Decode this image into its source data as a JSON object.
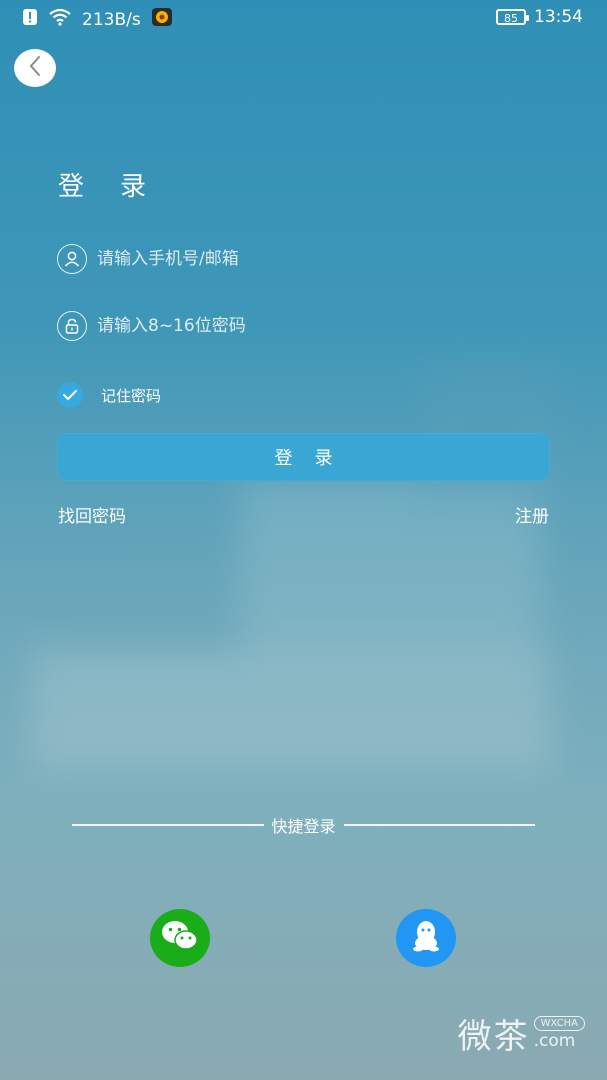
{
  "status_bar": {
    "speed": "213B/s",
    "battery": "85",
    "time": "13:54"
  },
  "login": {
    "title": "登录",
    "phone_placeholder": "请输入手机号/邮箱",
    "password_placeholder": "请输入8~16位密码",
    "remember_label": "记住密码",
    "remember_checked": true,
    "submit_label": "登录",
    "forgot_label": "找回密码",
    "register_label": "注册"
  },
  "quick_login": {
    "label": "快捷登录",
    "wechat_color": "#1aad19",
    "qq_color": "#2196f3"
  },
  "watermark": {
    "brand": "微茶",
    "badge": "WXCHA",
    "domain": ".com"
  },
  "colors": {
    "accent": "#36a9e0",
    "button": "#3aa6d3"
  }
}
